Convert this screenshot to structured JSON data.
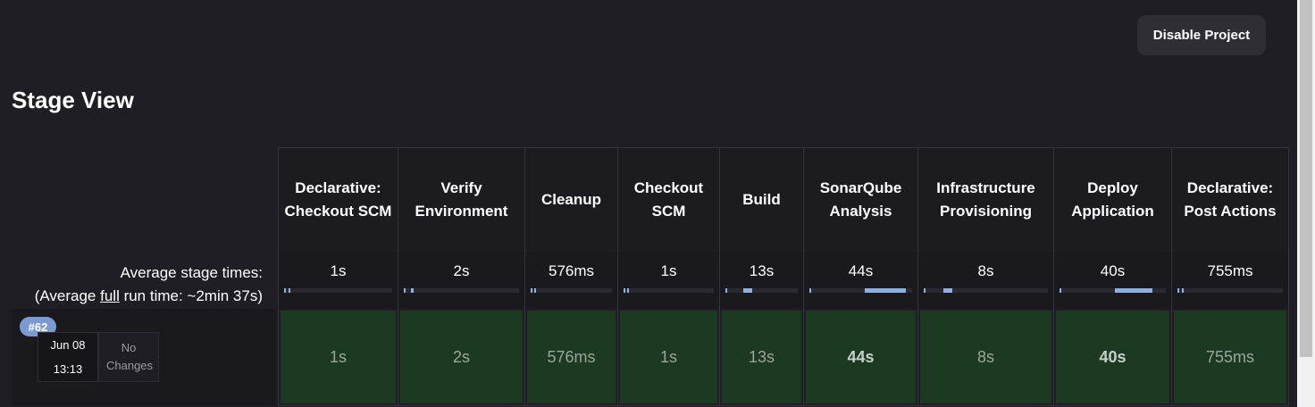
{
  "header": {
    "disable_button": "Disable Project"
  },
  "title": "Stage View",
  "summary": {
    "avg_label": "Average stage times:",
    "avg_full_prefix": "(Average ",
    "avg_full_link": "full",
    "avg_full_suffix": " run time: ~2min 37s)"
  },
  "stages": [
    {
      "name": "Declarative: Checkout SCM",
      "avg": "1s",
      "run": "1s",
      "fraction": 0.01
    },
    {
      "name": "Verify Environment",
      "avg": "2s",
      "run": "2s",
      "fraction": 0.02
    },
    {
      "name": "Cleanup",
      "avg": "576ms",
      "run": "576ms",
      "fraction": 0.01
    },
    {
      "name": "Checkout SCM",
      "avg": "1s",
      "run": "1s",
      "fraction": 0.01
    },
    {
      "name": "Build",
      "avg": "13s",
      "run": "13s",
      "fraction": 0.12
    },
    {
      "name": "SonarQube Analysis",
      "avg": "44s",
      "run": "44s",
      "fraction": 0.4
    },
    {
      "name": "Infrastructure Provisioning",
      "avg": "8s",
      "run": "8s",
      "fraction": 0.07
    },
    {
      "name": "Deploy Application",
      "avg": "40s",
      "run": "40s",
      "fraction": 0.36
    },
    {
      "name": "Declarative: Post Actions",
      "avg": "755ms",
      "run": "755ms",
      "fraction": 0.01
    }
  ],
  "run": {
    "number": "#62",
    "date": "Jun 08",
    "time": "13:13",
    "changes": "No Changes"
  },
  "colors": {
    "background": "#1f1e24",
    "success_cell": "#1c3a22",
    "bar": "#8eb0e0",
    "badge": "#7b9bd0"
  }
}
